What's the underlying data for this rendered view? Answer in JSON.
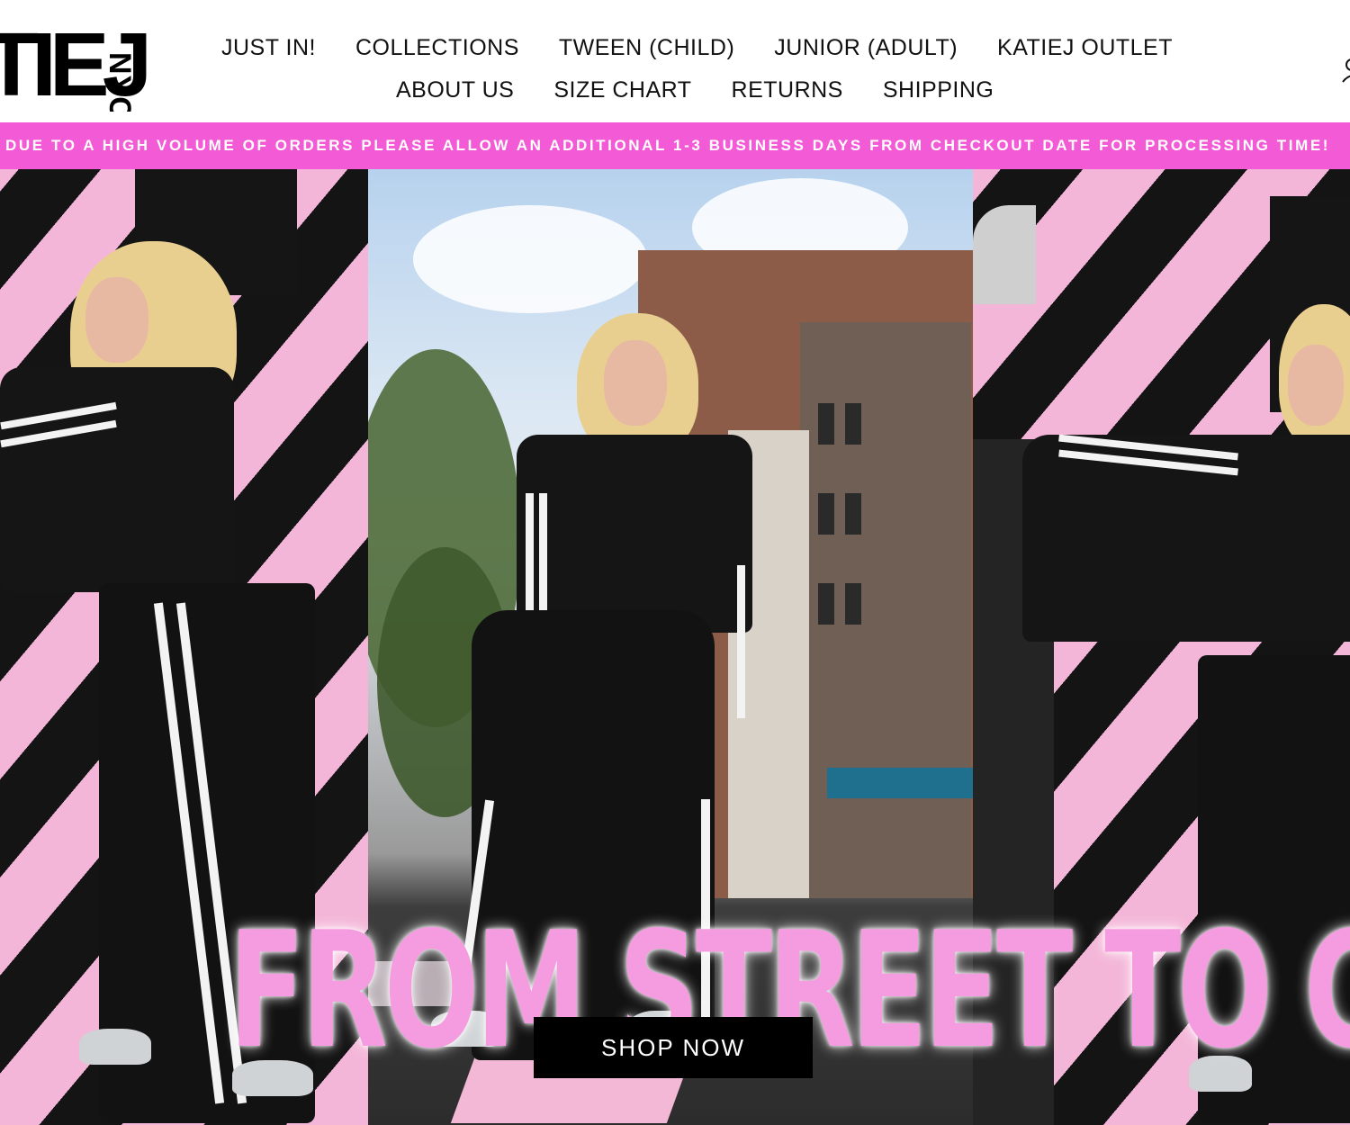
{
  "brand": {
    "logo_main": "TIEJ",
    "logo_sub": "NYC"
  },
  "nav": {
    "row1": [
      "JUST IN!",
      "COLLECTIONS",
      "TWEEN (CHILD)",
      "JUNIOR (ADULT)",
      "KATIEJ OUTLET"
    ],
    "row2": [
      "ABOUT US",
      "SIZE CHART",
      "RETURNS",
      "SHIPPING"
    ]
  },
  "announcement": "DUE TO A HIGH VOLUME OF ORDERS PLEASE ALLOW AN ADDITIONAL 1-3 BUSINESS DAYS FROM CHECKOUT DATE FOR PROCESSING TIME!",
  "hero": {
    "headline": "FROM STREET TO CHIC",
    "cta": "SHOP NOW"
  },
  "colors": {
    "accent_pink": "#f35bd6",
    "headline_pink": "#f59be0",
    "button_black": "#000000"
  }
}
